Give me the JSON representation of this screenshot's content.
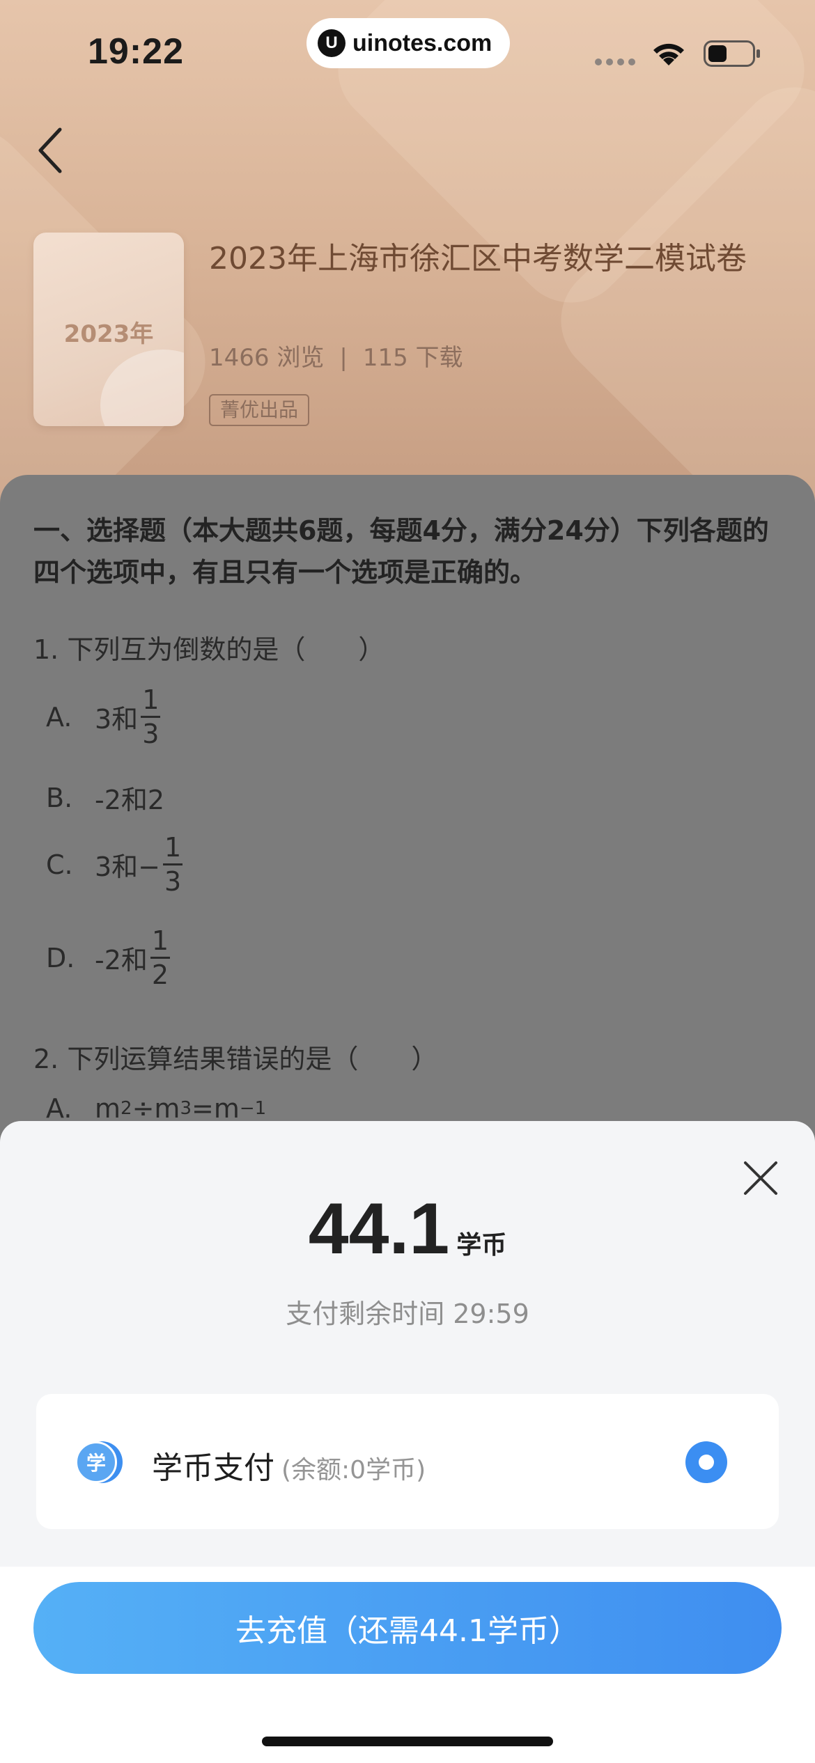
{
  "status_bar": {
    "time": "19:22",
    "watermark": "uinotes.com",
    "watermark_logo": "U"
  },
  "document": {
    "cover_text": "2023年",
    "title": "2023年上海市徐汇区中考数学二模试卷",
    "views": "1466 浏览",
    "separator": "|",
    "downloads": "115 下载",
    "tag": "菁优出品"
  },
  "content": {
    "section_intro": "一、选择题（本大题共6题，每题4分，满分24分）下列各题的四个选项中，有且只有一个选项是正确的。",
    "q1": {
      "text": "1. 下列互为倒数的是（　　）",
      "options": [
        {
          "letter": "A.",
          "prefix": "3和",
          "num": "1",
          "den": "3"
        },
        {
          "letter": "B.",
          "prefix": "-2和2"
        },
        {
          "letter": "C.",
          "prefix": "3和−",
          "num": "1",
          "den": "3"
        },
        {
          "letter": "D.",
          "prefix": "-2和",
          "num": "1",
          "den": "2"
        }
      ]
    },
    "q2": {
      "text": "2. 下列运算结果错误的是（　　）",
      "option_a": {
        "letter": "A.",
        "m1": "m",
        "e1": "2",
        "op": "÷m",
        "e2": "3",
        "eq": "=m",
        "e3": "−1"
      }
    }
  },
  "payment": {
    "amount": "44.1",
    "unit": "学币",
    "countdown_label": "支付剩余时间",
    "countdown_value": "29:59",
    "method_icon_text": "学",
    "method_label": "学币支付",
    "balance": "(余额:0学币)",
    "recharge_button": "去充值（还需44.1学币）"
  },
  "colors": {
    "accent_blue": "#3b8ef2",
    "title_brown": "#6f4a33"
  },
  "icons": [
    "back-icon",
    "wifi-icon",
    "battery-icon",
    "close-icon",
    "coin-icon",
    "radio-selected-icon"
  ]
}
